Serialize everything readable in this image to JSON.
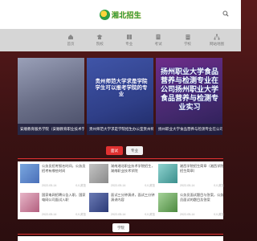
{
  "header": {
    "logo_text": "湘北招生",
    "search_icon": "search-icon"
  },
  "nav": {
    "items": [
      {
        "label": "首页",
        "icon": "home-icon"
      },
      {
        "label": "院校",
        "icon": "school-icon"
      },
      {
        "label": "专业",
        "icon": "book-icon"
      },
      {
        "label": "考试",
        "icon": "exam-icon"
      },
      {
        "label": "学校",
        "icon": "building-icon"
      },
      {
        "label": "网站地图",
        "icon": "sitemap-icon"
      }
    ]
  },
  "banners": [
    {
      "caption": "安顺教育服务学院（安顺教育职业技术学院）",
      "overlay": ""
    },
    {
      "caption": "贵州师范大学求是学院招生办公室贵州师范大学",
      "overlay": "贵州师范大学求是学院学生可以报考学院的专业"
    },
    {
      "caption": "扬州职业大学食品营养与检测专业在公司实习",
      "overlay": "扬州职业大学食品营养与检测专业在公司扬州职业大学食品营养与检测专业实习"
    }
  ],
  "tabs": {
    "active": "面试",
    "idle": "专业"
  },
  "articles": [
    {
      "title": "公务员招考报名时间，公务员招考有哪些时间",
      "date": "2022-05-14",
      "views": "0人浏览"
    },
    {
      "title": "湖南湘北职业技术学院招生，湖南职业技术学院",
      "date": "2022-05-14",
      "views": "0人浏览"
    },
    {
      "title": "湘西学院招生简章（湘西学院招生简章）",
      "date": "2022-05-14",
      "views": "0人浏览"
    },
    {
      "title": "国家电网招聘公告入职，国家电网公司面试入职",
      "date": "2022-05-14",
      "views": "0人浏览"
    },
    {
      "title": "面试三分钟演讲，面试三分钟演讲内容",
      "date": "2022-05-14",
      "views": "0人浏览"
    },
    {
      "title": "公务员面试题目与答案，公务员面试的题目及答案",
      "date": "2022-05-14",
      "views": "0人浏览"
    }
  ],
  "bottom_tab": "学院",
  "colors": {
    "accent": "#e03131",
    "background": "#3a1213",
    "nav_bg": "#d6d6d6"
  }
}
